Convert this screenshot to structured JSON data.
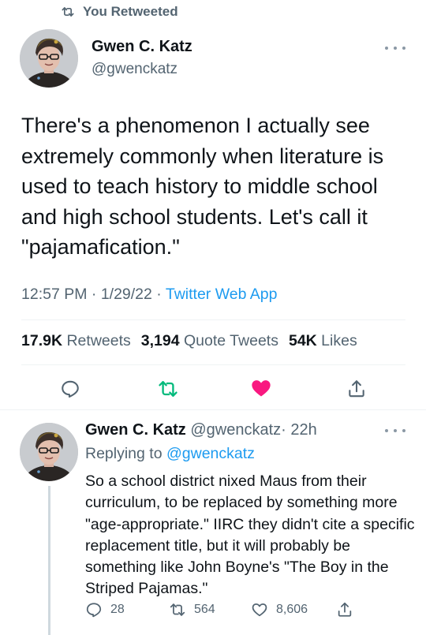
{
  "retweet_banner": {
    "icon": "retweet-icon",
    "text": "You Retweeted"
  },
  "main_tweet": {
    "author": {
      "name": "Gwen C. Katz",
      "handle": "@gwenckatz"
    },
    "text": "There's a phenomenon I actually see extremely commonly when literature is used to teach history to middle school and high school students. Let's call it \"pajamafication.\"",
    "time": "12:57 PM",
    "date": "1/29/22",
    "source": "Twitter Web App",
    "stats": {
      "retweets_count": "17.9K",
      "retweets_label": "Retweets",
      "quotes_count": "3,194",
      "quotes_label": "Quote Tweets",
      "likes_count": "54K",
      "likes_label": "Likes"
    },
    "actions": [
      "reply-icon",
      "retweet-icon",
      "like-icon",
      "share-icon"
    ],
    "colors": {
      "retweet_active": "#00ba7c",
      "like_active": "#f91880",
      "link": "#1d9bf0"
    }
  },
  "reply_tweet": {
    "author": {
      "name": "Gwen C. Katz",
      "handle": "@gwenckatz"
    },
    "separator": "·",
    "age": "22h",
    "replying_to_label": "Replying to",
    "replying_to_handle": "@gwenckatz",
    "text": "So a school district nixed Maus from their curriculum, to be replaced by something more \"age-appropriate.\" IIRC they didn't cite a specific replacement title, but it will probably be something like John Boyne's \"The Boy in the Striped Pajamas.\"",
    "counts": {
      "replies": "28",
      "retweets": "564",
      "likes": "8,606"
    }
  }
}
